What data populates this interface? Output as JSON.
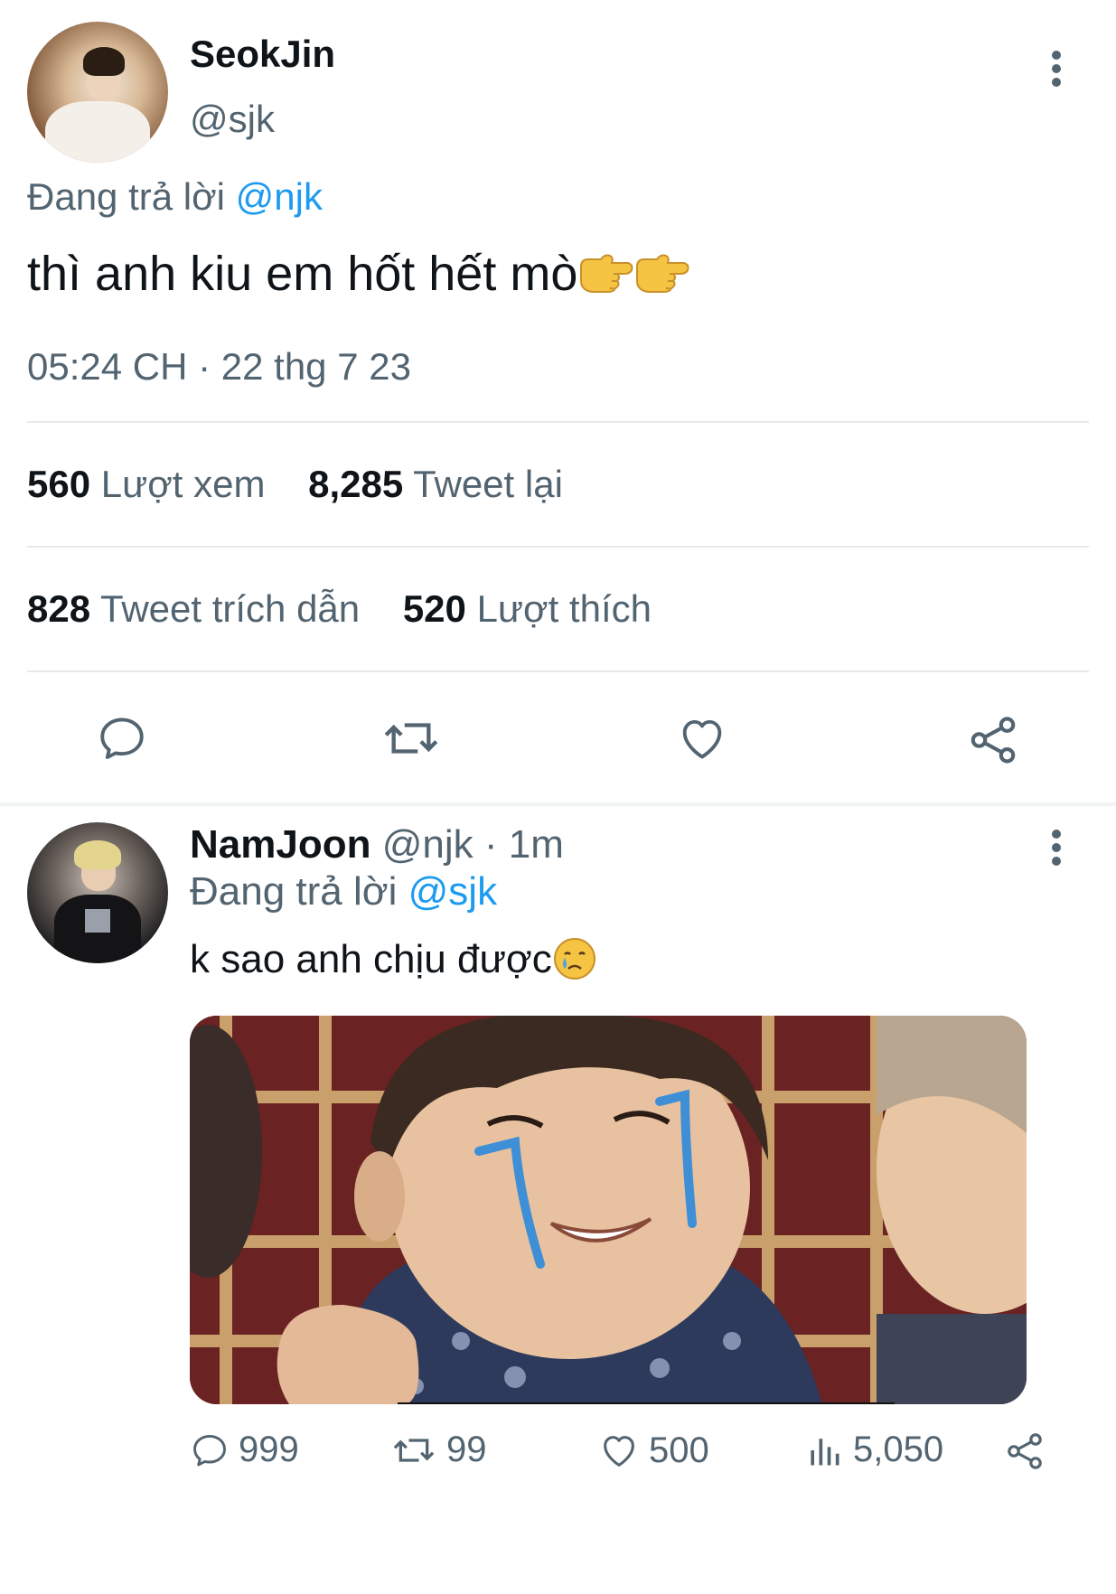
{
  "main_tweet": {
    "author": {
      "display_name": "SeokJin",
      "handle": "@sjk"
    },
    "replying_to_prefix": "Đang trả lời",
    "replying_to_handle": "@njk",
    "text": "thì anh kiu em hốt hết mò",
    "text_emoji": [
      "backhand-index-pointing-right",
      "backhand-index-pointing-right"
    ],
    "timestamp": "05:24 CH · 22 thg 7 23",
    "stats": {
      "views_count": "560",
      "views_label": "Lượt xem",
      "retweets_count": "8,285",
      "retweets_label": "Tweet lại",
      "quotes_count": "828",
      "quotes_label": "Tweet trích dẫn",
      "likes_count": "520",
      "likes_label": "Lượt thích"
    },
    "actions": [
      "reply-icon",
      "retweet-icon",
      "like-icon",
      "share-icon"
    ]
  },
  "reply_tweet": {
    "author": {
      "display_name": "NamJoon",
      "handle": "@njk",
      "time": "1m"
    },
    "separator": " · ",
    "replying_to_prefix": "Đang trả lời",
    "replying_to_handle": "@sjk",
    "text": "k sao anh chịu được",
    "text_emoji": "crying-face",
    "media": {
      "type": "photo",
      "description_colors": {
        "background": "#5b1d1d",
        "lattice": "#c9a06b",
        "tears": "#3f8fd6"
      }
    },
    "actions": {
      "reply_count": "999",
      "retweet_count": "99",
      "like_count": "500",
      "views_count": "5,050"
    }
  },
  "colors": {
    "text_primary": "#0f1419",
    "text_secondary": "#536471",
    "link": "#1d9bf0",
    "divider": "#e6e9ec",
    "section_divider": "#eff3f4"
  }
}
